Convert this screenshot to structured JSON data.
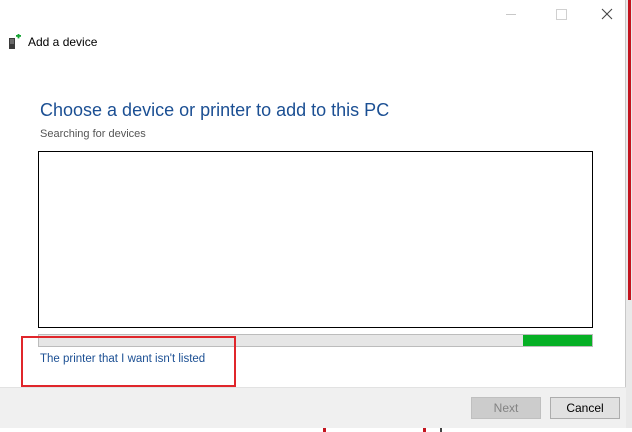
{
  "window": {
    "title": "Add a device",
    "icons": {
      "app": "add-device-icon",
      "minimize": "minimize-icon",
      "maximize": "maximize-icon",
      "close": "close-icon"
    }
  },
  "main": {
    "heading": "Choose a device or printer to add to this PC",
    "status": "Searching for devices",
    "device_list": [],
    "progress": {
      "indeterminate": true,
      "segment_start": 0.875,
      "segment_end": 1.0,
      "color": "#06b025"
    },
    "printer_link": "The printer that I want isn't listed",
    "highlight_color": "#e0262b"
  },
  "footer": {
    "next_label": "Next",
    "next_enabled": false,
    "cancel_label": "Cancel"
  }
}
